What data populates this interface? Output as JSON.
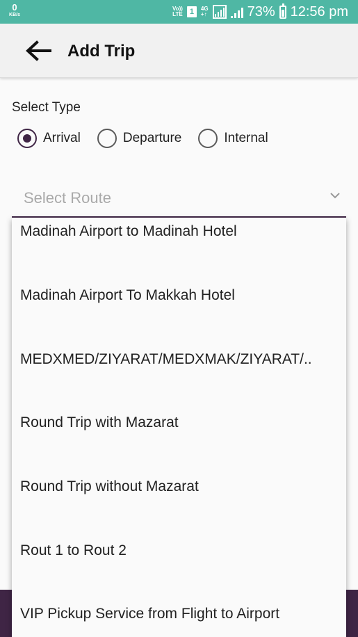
{
  "status_bar": {
    "net_speed": "0",
    "net_speed_unit": "KB/s",
    "volte_top": "Vo))",
    "volte_bottom": "LTE",
    "sim_slot": "1",
    "network_type_top": "4G",
    "network_type_bottom": "+↑",
    "battery_percent": "73%",
    "time": "12:56 pm",
    "background_color": "#4fb7a4"
  },
  "app_bar": {
    "back_icon": "arrow-back-icon",
    "title": "Add Trip"
  },
  "select_type": {
    "label": "Select Type",
    "options": [
      {
        "label": "Arrival",
        "checked": true
      },
      {
        "label": "Departure",
        "checked": false
      },
      {
        "label": "Internal",
        "checked": false
      }
    ]
  },
  "route": {
    "placeholder": "Select Route",
    "chevron_icon": "chevron-down-icon",
    "options": [
      "Madinah Airport to Madinah Hotel",
      "Madinah Airport To Makkah Hotel",
      "MEDXMED/ZIYARAT/MEDXMAK/ZIYARAT/..",
      "Round Trip with Mazarat",
      "Round Trip without Mazarat",
      "Rout 1 to Rout 2",
      "VIP Pickup Service from Flight to Airport"
    ]
  },
  "colors": {
    "accent": "#3f2545",
    "app_bar": "#f1f1f1",
    "placeholder": "#a9a9a9"
  }
}
